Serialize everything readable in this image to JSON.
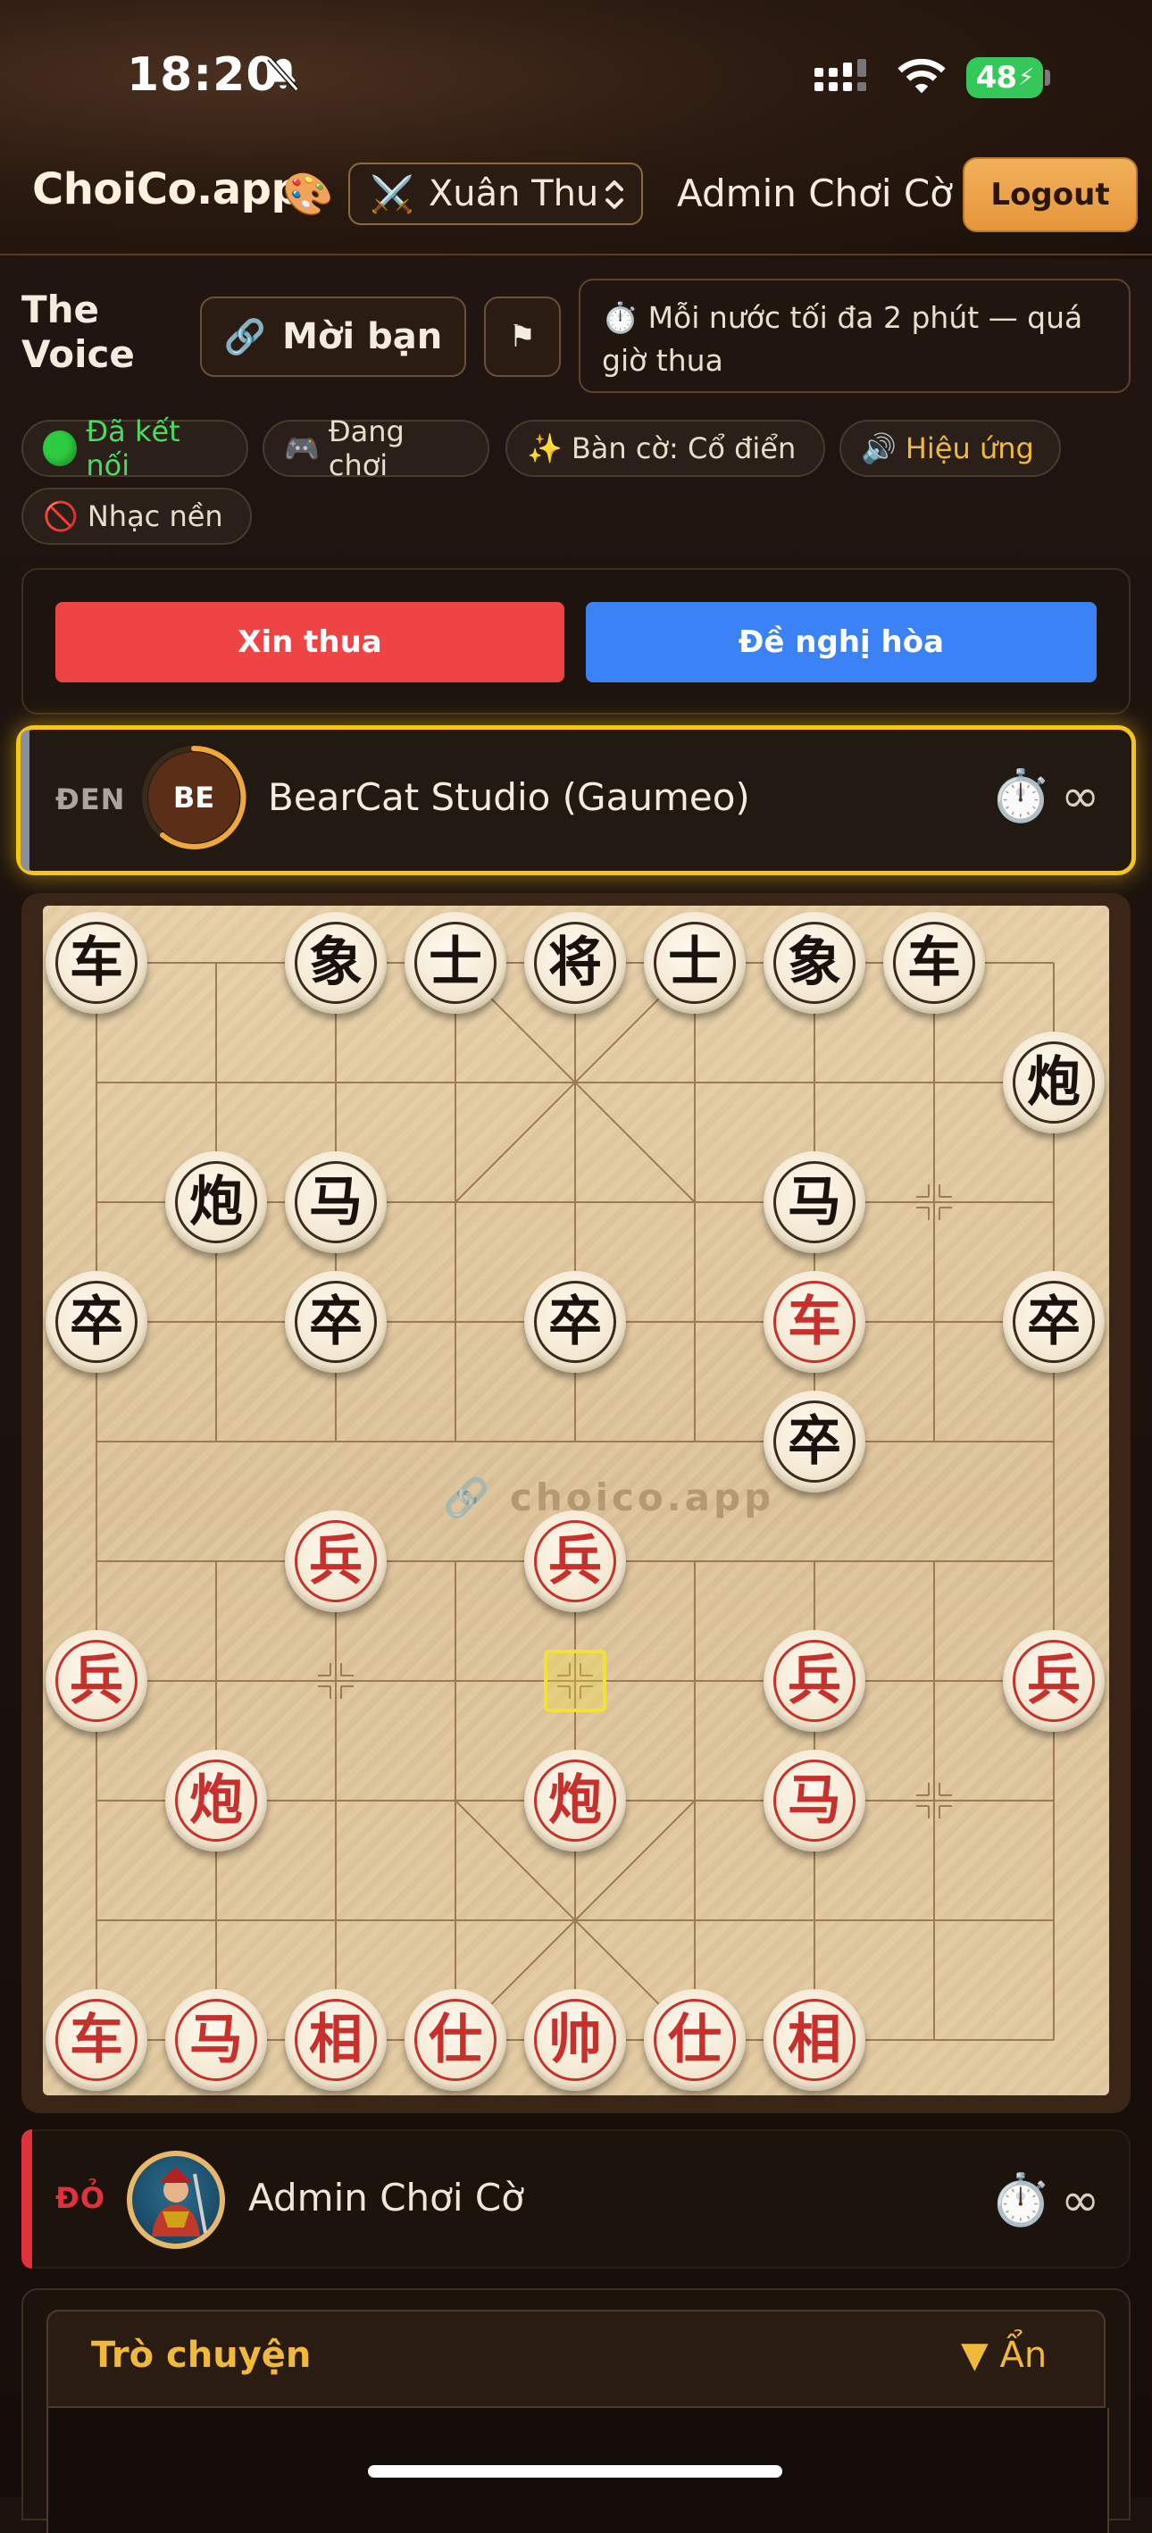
{
  "status_bar": {
    "time": "18:20",
    "battery": "48",
    "icons": [
      "bell-slash-icon",
      "signal-icon",
      "wifi-icon",
      "battery-charging-icon"
    ]
  },
  "header": {
    "logo": "ChoiCo.app",
    "logo_emoji": "🎨",
    "room_name": "Xuân Thu",
    "room_icon": "⚔️",
    "user_name": "Admin Chơi Cờ",
    "logout_label": "Logout"
  },
  "info": {
    "voice_label_line1": "The",
    "voice_label_line2": "Voice",
    "invite_label": "Mời bạn",
    "invite_icon": "🔗",
    "flag_icon": "⚑",
    "timer_note": "⏱️ Mỗi nước tối đa 2 phút — quá giờ thua"
  },
  "chips": {
    "connected": "Đã kết nối",
    "playing_icon": "🎮",
    "playing": "Đang chơi",
    "board_icon": "✨",
    "board": "Bàn cờ: Cổ điển",
    "effects_icon": "🔊",
    "effects": "Hiệu ứng",
    "music_icon": "🚫",
    "music": "Nhạc nền"
  },
  "actions": {
    "resign": "Xin thua",
    "draw": "Đề nghị hòa"
  },
  "player_black": {
    "side": "ĐEN",
    "avatar_initials": "BE",
    "name": "BearCat Studio (Gaumeo)",
    "clock_icon": "⏱️",
    "time": "∞"
  },
  "player_red": {
    "side": "ĐỎ",
    "name": "Admin Chơi Cờ",
    "clock_icon": "⏱️",
    "time": "∞"
  },
  "board": {
    "watermark": "🔗 choico.app",
    "last_move": [
      4,
      6
    ],
    "pieces": [
      {
        "c": "车",
        "side": "black",
        "file": 0,
        "rank": 0
      },
      {
        "c": "象",
        "side": "black",
        "file": 2,
        "rank": 0
      },
      {
        "c": "士",
        "side": "black",
        "file": 3,
        "rank": 0
      },
      {
        "c": "将",
        "side": "black",
        "file": 4,
        "rank": 0
      },
      {
        "c": "士",
        "side": "black",
        "file": 5,
        "rank": 0
      },
      {
        "c": "象",
        "side": "black",
        "file": 6,
        "rank": 0
      },
      {
        "c": "车",
        "side": "black",
        "file": 7,
        "rank": 0
      },
      {
        "c": "炮",
        "side": "black",
        "file": 8,
        "rank": 1
      },
      {
        "c": "炮",
        "side": "black",
        "file": 1,
        "rank": 2
      },
      {
        "c": "马",
        "side": "black",
        "file": 2,
        "rank": 2
      },
      {
        "c": "马",
        "side": "black",
        "file": 6,
        "rank": 2
      },
      {
        "c": "卒",
        "side": "black",
        "file": 0,
        "rank": 3
      },
      {
        "c": "卒",
        "side": "black",
        "file": 2,
        "rank": 3
      },
      {
        "c": "卒",
        "side": "black",
        "file": 4,
        "rank": 3
      },
      {
        "c": "车",
        "side": "red",
        "file": 6,
        "rank": 3
      },
      {
        "c": "卒",
        "side": "black",
        "file": 8,
        "rank": 3
      },
      {
        "c": "卒",
        "side": "black",
        "file": 6,
        "rank": 4
      },
      {
        "c": "兵",
        "side": "red",
        "file": 2,
        "rank": 5
      },
      {
        "c": "兵",
        "side": "red",
        "file": 4,
        "rank": 5
      },
      {
        "c": "兵",
        "side": "red",
        "file": 0,
        "rank": 6
      },
      {
        "c": "兵",
        "side": "red",
        "file": 6,
        "rank": 6
      },
      {
        "c": "兵",
        "side": "red",
        "file": 8,
        "rank": 6
      },
      {
        "c": "炮",
        "side": "red",
        "file": 1,
        "rank": 7
      },
      {
        "c": "炮",
        "side": "red",
        "file": 4,
        "rank": 7
      },
      {
        "c": "马",
        "side": "red",
        "file": 6,
        "rank": 7
      },
      {
        "c": "车",
        "side": "red",
        "file": 0,
        "rank": 9
      },
      {
        "c": "马",
        "side": "red",
        "file": 1,
        "rank": 9
      },
      {
        "c": "相",
        "side": "red",
        "file": 2,
        "rank": 9
      },
      {
        "c": "仕",
        "side": "red",
        "file": 3,
        "rank": 9
      },
      {
        "c": "帅",
        "side": "red",
        "file": 4,
        "rank": 9
      },
      {
        "c": "仕",
        "side": "red",
        "file": 5,
        "rank": 9
      },
      {
        "c": "相",
        "side": "red",
        "file": 6,
        "rank": 9
      }
    ]
  },
  "chat": {
    "title": "Trò chuyện",
    "toggle": "▼ Ẩn"
  },
  "colors": {
    "accent": "#f0b93a",
    "resign": "#ef4444",
    "draw": "#3b82f6",
    "active_turn_border": "#f5c518",
    "red_side": "#e0323c"
  }
}
